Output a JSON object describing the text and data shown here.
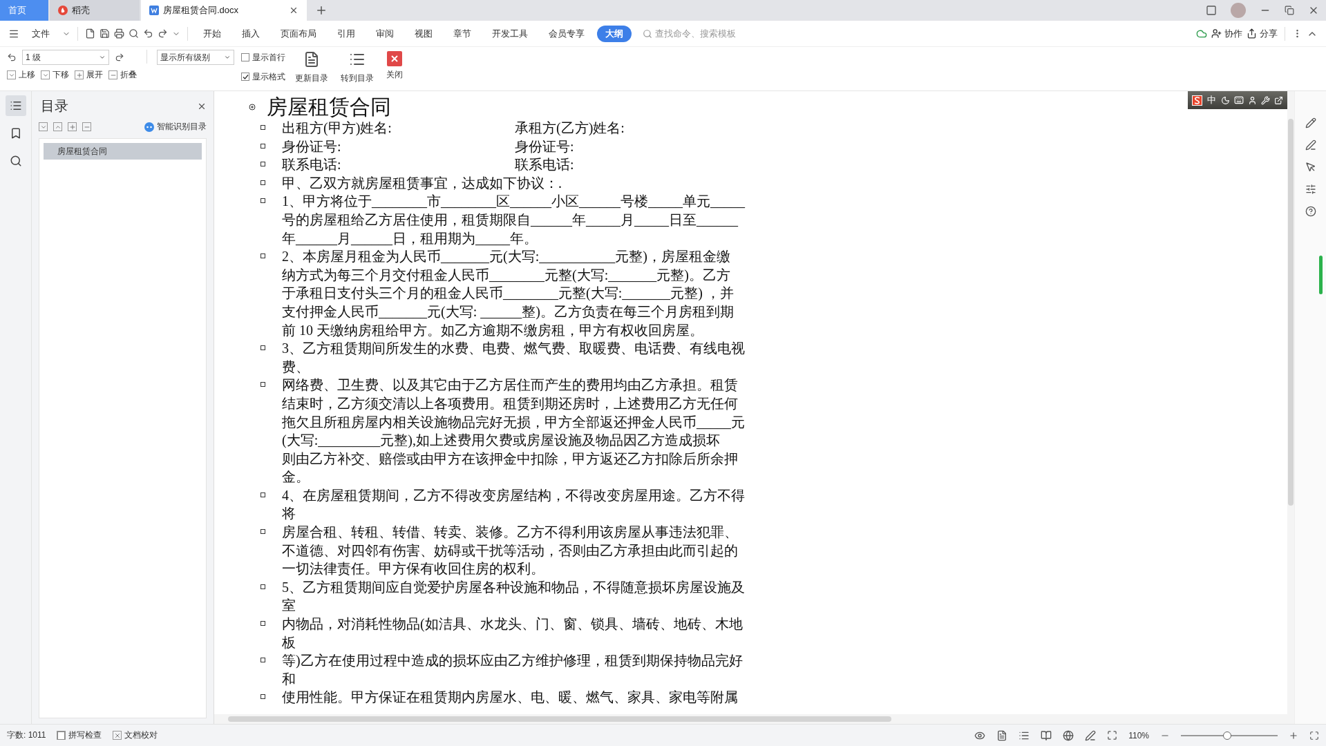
{
  "tabs": [
    {
      "label": "首页",
      "kind": "home",
      "selected": false
    },
    {
      "label": "稻壳",
      "kind": "app",
      "selected": false
    },
    {
      "label": "房屋租赁合同.docx",
      "kind": "doc",
      "selected": true
    }
  ],
  "menu": {
    "file": "文件",
    "items": [
      {
        "label": "开始",
        "selected": false
      },
      {
        "label": "插入",
        "selected": false
      },
      {
        "label": "页面布局",
        "selected": false
      },
      {
        "label": "引用",
        "selected": false
      },
      {
        "label": "审阅",
        "selected": false
      },
      {
        "label": "视图",
        "selected": false
      },
      {
        "label": "章节",
        "selected": false
      },
      {
        "label": "开发工具",
        "selected": false
      },
      {
        "label": "会员专享",
        "selected": false
      },
      {
        "label": "大纲",
        "selected": true
      }
    ],
    "search_placeholder": "查找命令、搜索模板",
    "collab": "协作",
    "share": "分享"
  },
  "toolbar": {
    "level_select": "1 级",
    "show_select": "显示所有级别",
    "checks": [
      {
        "label": "显示首行",
        "checked": false
      },
      {
        "label": "显示格式",
        "checked": true
      }
    ],
    "moves": [
      {
        "label": "上移",
        "kind": "down"
      },
      {
        "label": "下移",
        "kind": "up"
      },
      {
        "label": "展开",
        "kind": "plus"
      },
      {
        "label": "折叠",
        "kind": "minus"
      }
    ],
    "buttons": [
      {
        "label": "更新目录",
        "kind": "update"
      },
      {
        "label": "转到目录",
        "kind": "goto"
      },
      {
        "label": "关闭",
        "kind": "close"
      }
    ]
  },
  "ime": {
    "label": "中"
  },
  "nav": {
    "title": "目录",
    "smart": "智能识别目录",
    "items": [
      {
        "label": "房屋租赁合同",
        "selected": true
      }
    ]
  },
  "document": {
    "title": "房屋租赁合同",
    "paragraphs": [
      {
        "kind": "pair",
        "left": "出租方(甲方)姓名:",
        "right": "承租方(乙方)姓名:"
      },
      {
        "kind": "pair",
        "left": "身份证号:",
        "right": "身份证号:"
      },
      {
        "kind": "pair",
        "left": "联系电话:",
        "right": "联系电话:"
      },
      {
        "kind": "text",
        "lines": [
          "甲、乙双方就房屋租赁事宜，达成如下协议：."
        ]
      },
      {
        "kind": "text",
        "lines": [
          "1、甲方将位于________市________区______小区______号楼_____单元_____",
          "号的房屋租给乙方居住使用，租赁期限自______年_____月_____日至______",
          "年______月______日，租用期为_____年。"
        ]
      },
      {
        "kind": "text",
        "lines": [
          "2、本房屋月租金为人民币_______元(大写:___________元整)，房屋租金缴",
          "纳方式为每三个月交付租金人民币________元整(大写:_______元整)。乙方",
          "于承租日支付头三个月的租金人民币________元整(大写:_______元整) ，并",
          "支付押金人民币_______元(大写: ______整)。乙方负责在每三个月房租到期",
          "前 10 天缴纳房租给甲方。如乙方逾期不缴房租，甲方有权收回房屋。"
        ]
      },
      {
        "kind": "text",
        "lines": [
          "3、乙方租赁期间所发生的水费、电费、燃气费、取暖费、电话费、有线电视",
          "费、"
        ]
      },
      {
        "kind": "text",
        "lines": [
          "网络费、卫生费、以及其它由于乙方居住而产生的费用均由乙方承担。租赁",
          "结束时，乙方须交清以上各项费用。租赁到期还房时，上述费用乙方无任何",
          "拖欠且所租房屋内相关设施物品完好无损，甲方全部返还押金人民币_____元",
          "(大写:_________元整),如上述费用欠费或房屋设施及物品因乙方造成损坏",
          "则由乙方补交、赔偿或由甲方在该押金中扣除，甲方返还乙方扣除后所余押",
          "金。"
        ]
      },
      {
        "kind": "text",
        "lines": [
          "4、在房屋租赁期间，乙方不得改变房屋结构，不得改变房屋用途。乙方不得",
          "将"
        ]
      },
      {
        "kind": "text",
        "lines": [
          "房屋合租、转租、转借、转卖、装修。乙方不得利用该房屋从事违法犯罪、",
          "不道德、对四邻有伤害、妨碍或干扰等活动，否则由乙方承担由此而引起的",
          "一切法律责任。甲方保有收回住房的权利。"
        ]
      },
      {
        "kind": "text",
        "lines": [
          "5、乙方租赁期间应自觉爱护房屋各种设施和物品，不得随意损坏房屋设施及",
          "室"
        ]
      },
      {
        "kind": "text",
        "lines": [
          "内物品，对消耗性物品(如洁具、水龙头、门、窗、锁具、墙砖、地砖、木地",
          "板"
        ]
      },
      {
        "kind": "text",
        "lines": [
          "等)乙方在使用过程中造成的损坏应由乙方维护修理，租赁到期保持物品完好",
          "和"
        ]
      },
      {
        "kind": "text",
        "lines": [
          "使用性能。甲方保证在租赁期内房屋水、电、暖、燃气、家具、家电等附属"
        ]
      }
    ]
  },
  "status": {
    "word_count": "字数: 1011",
    "tools": [
      {
        "label": "拼写检查",
        "kind": "check"
      },
      {
        "label": "文档校对",
        "kind": "proof"
      }
    ],
    "zoom": "110%",
    "zoom_slider": {
      "level": 0.48
    }
  }
}
